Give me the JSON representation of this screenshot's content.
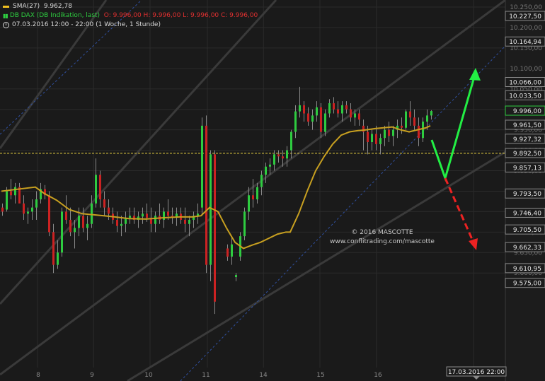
{
  "legend": {
    "sma_label": "SMA(27)",
    "sma_value": "9.962,78",
    "instrument": "DB DAX (DB Indikation, last)",
    "ohlc": "O: 9.996,00  H: 9.996,00  L: 9.996,00  C: 9.996,00",
    "period": "07.03.2016 12:00 - 22:00 (1 Woche, 1 Stunde)"
  },
  "watermark": {
    "line1": "© 2016 MASCOTTE",
    "line2": "www.conflitrading.com/mascotte"
  },
  "colors": {
    "background": "#1a1a1a",
    "up_candle": "#2ecc40",
    "down_candle": "#cc2222",
    "sma": "#c8a020",
    "channel": "#3a3a3a",
    "trend_dotted": "#3050a0",
    "support_line": "#e8d040",
    "arrow_up": "#22ee44",
    "arrow_down": "#ee2222"
  },
  "chart_data": {
    "type": "candlestick",
    "x_ticks": [
      "8",
      "9",
      "10",
      "11",
      "14",
      "15",
      "16"
    ],
    "y_ticks": [
      "10.250,00",
      "10.200,00",
      "10.150,00",
      "10.100,00",
      "10.050,00",
      "10.000,00",
      "9.950,00",
      "9.900,00",
      "9.850,00",
      "9.800,00",
      "9.750,00",
      "9.700,00",
      "9.650,00",
      "9.600,00"
    ],
    "ylim": [
      9565,
      10265
    ],
    "price_boxes": [
      {
        "label": "10.227,50",
        "value": 10227.5
      },
      {
        "label": "10.164,94",
        "value": 10164.94
      },
      {
        "label": "10.066,00",
        "value": 10066.0
      },
      {
        "label": "10.033,50",
        "value": 10033.5
      },
      {
        "label": "9.996,00",
        "value": 9996.0,
        "current": true
      },
      {
        "label": "9.961,50",
        "value": 9961.5
      },
      {
        "label": "9.927,32",
        "value": 9927.32
      },
      {
        "label": "9.892,50",
        "value": 9892.5
      },
      {
        "label": "9.857,13",
        "value": 9857.13
      },
      {
        "label": "9.793,50",
        "value": 9793.5
      },
      {
        "label": "9.746,40",
        "value": 9746.4
      },
      {
        "label": "9.705,50",
        "value": 9705.5
      },
      {
        "label": "9.662,33",
        "value": 9662.33
      },
      {
        "label": "9.610,95",
        "value": 9610.95
      },
      {
        "label": "9.575,00",
        "value": 9575.0
      }
    ],
    "date_box": "17.03.2016 22:00",
    "support_level": 9892.5,
    "sma_path": [
      [
        0,
        9800
      ],
      [
        4,
        9805
      ],
      [
        8,
        9810
      ],
      [
        10,
        9795
      ],
      [
        13,
        9778
      ],
      [
        16,
        9755
      ],
      [
        19,
        9745
      ],
      [
        22,
        9742
      ],
      [
        26,
        9738
      ],
      [
        30,
        9733
      ],
      [
        34,
        9732
      ],
      [
        38,
        9735
      ],
      [
        42,
        9737
      ],
      [
        45,
        9737
      ],
      [
        47,
        9740
      ],
      [
        49,
        9760
      ],
      [
        51,
        9750
      ],
      [
        53,
        9710
      ],
      [
        55,
        9675
      ],
      [
        57,
        9660
      ],
      [
        59,
        9668
      ],
      [
        61,
        9675
      ],
      [
        63,
        9685
      ],
      [
        65,
        9695
      ],
      [
        67,
        9700
      ],
      [
        68,
        9700
      ],
      [
        70,
        9745
      ],
      [
        72,
        9800
      ],
      [
        74,
        9850
      ],
      [
        76,
        9885
      ],
      [
        78,
        9915
      ],
      [
        80,
        9937
      ],
      [
        82,
        9945
      ],
      [
        84,
        9948
      ],
      [
        86,
        9950
      ],
      [
        88,
        9953
      ],
      [
        90,
        9955
      ],
      [
        92,
        9957
      ],
      [
        94,
        9950
      ],
      [
        96,
        9945
      ],
      [
        98,
        9950
      ],
      [
        100,
        9955
      ],
      [
        101,
        9960
      ]
    ],
    "candles": [
      [
        0,
        9760,
        9770,
        9740,
        9750
      ],
      [
        1,
        9755,
        9810,
        9750,
        9800
      ],
      [
        2,
        9800,
        9830,
        9780,
        9790
      ],
      [
        3,
        9790,
        9820,
        9770,
        9810
      ],
      [
        4,
        9810,
        9820,
        9780,
        9770
      ],
      [
        5,
        9770,
        9790,
        9730,
        9745
      ],
      [
        6,
        9745,
        9760,
        9720,
        9750
      ],
      [
        7,
        9750,
        9780,
        9730,
        9760
      ],
      [
        8,
        9760,
        9800,
        9730,
        9780
      ],
      [
        9,
        9780,
        9820,
        9770,
        9805
      ],
      [
        10,
        9805,
        9815,
        9780,
        9790
      ],
      [
        11,
        9790,
        9800,
        9690,
        9700
      ],
      [
        12,
        9700,
        9720,
        9600,
        9620
      ],
      [
        13,
        9620,
        9680,
        9610,
        9650
      ],
      [
        14,
        9650,
        9760,
        9640,
        9750
      ],
      [
        15,
        9750,
        9790,
        9720,
        9730
      ],
      [
        16,
        9730,
        9760,
        9690,
        9700
      ],
      [
        17,
        9700,
        9730,
        9660,
        9710
      ],
      [
        18,
        9710,
        9760,
        9690,
        9740
      ],
      [
        19,
        9740,
        9760,
        9700,
        9710
      ],
      [
        20,
        9710,
        9740,
        9680,
        9720
      ],
      [
        21,
        9720,
        9790,
        9710,
        9770
      ],
      [
        22,
        9770,
        9880,
        9760,
        9840
      ],
      [
        23,
        9840,
        9850,
        9760,
        9780
      ],
      [
        24,
        9780,
        9800,
        9740,
        9760
      ],
      [
        25,
        9760,
        9780,
        9730,
        9745
      ],
      [
        26,
        9745,
        9760,
        9720,
        9730
      ],
      [
        27,
        9730,
        9750,
        9700,
        9715
      ],
      [
        28,
        9715,
        9740,
        9690,
        9720
      ],
      [
        29,
        9720,
        9750,
        9700,
        9735
      ],
      [
        30,
        9735,
        9760,
        9720,
        9740
      ],
      [
        31,
        9740,
        9760,
        9720,
        9730
      ],
      [
        32,
        9730,
        9750,
        9710,
        9738
      ],
      [
        33,
        9738,
        9760,
        9720,
        9745
      ],
      [
        34,
        9745,
        9770,
        9725,
        9735
      ],
      [
        35,
        9735,
        9760,
        9700,
        9720
      ],
      [
        36,
        9720,
        9750,
        9700,
        9740
      ],
      [
        37,
        9740,
        9770,
        9720,
        9730
      ],
      [
        38,
        9730,
        9760,
        9710,
        9750
      ],
      [
        39,
        9750,
        9780,
        9730,
        9740
      ],
      [
        40,
        9740,
        9760,
        9720,
        9735
      ],
      [
        41,
        9735,
        9760,
        9715,
        9745
      ],
      [
        42,
        9745,
        9760,
        9720,
        9730
      ],
      [
        43,
        9730,
        9760,
        9700,
        9720
      ],
      [
        44,
        9720,
        9740,
        9690,
        9730
      ],
      [
        45,
        9730,
        9750,
        9710,
        9740
      ],
      [
        46,
        9740,
        9770,
        9720,
        9745
      ],
      [
        47,
        9760,
        9980,
        9740,
        9960
      ],
      [
        48,
        9960,
        9985,
        9600,
        9620
      ],
      [
        49,
        9620,
        9900,
        9580,
        9890
      ],
      [
        50,
        9890,
        9900,
        9500,
        9530
      ],
      [
        53,
        9660,
        9670,
        9630,
        9640
      ],
      [
        54,
        9640,
        9690,
        9620,
        9670
      ],
      [
        55,
        9590,
        9600,
        9580,
        9595
      ],
      [
        56,
        9640,
        9700,
        9630,
        9690
      ],
      [
        57,
        9690,
        9760,
        9680,
        9750
      ],
      [
        58,
        9750,
        9810,
        9730,
        9790
      ],
      [
        59,
        9790,
        9830,
        9760,
        9780
      ],
      [
        60,
        9780,
        9820,
        9770,
        9810
      ],
      [
        61,
        9810,
        9850,
        9790,
        9840
      ],
      [
        62,
        9840,
        9870,
        9820,
        9860
      ],
      [
        63,
        9860,
        9880,
        9840,
        9865
      ],
      [
        64,
        9865,
        9900,
        9850,
        9890
      ],
      [
        65,
        9890,
        9900,
        9870,
        9885
      ],
      [
        66,
        9885,
        9900,
        9860,
        9880
      ],
      [
        67,
        9880,
        9910,
        9860,
        9900
      ],
      [
        68,
        9900,
        9950,
        9880,
        9945
      ],
      [
        69,
        9945,
        10010,
        9930,
        9995
      ],
      [
        70,
        9995,
        10055,
        9980,
        10010
      ],
      [
        71,
        10010,
        10020,
        9970,
        9990
      ],
      [
        72,
        9990,
        10005,
        9960,
        9970
      ],
      [
        73,
        9970,
        10000,
        9950,
        9985
      ],
      [
        74,
        9985,
        10020,
        9970,
        10005
      ],
      [
        75,
        10005,
        10015,
        9930,
        9945
      ],
      [
        76,
        9945,
        10000,
        9935,
        9990
      ],
      [
        77,
        9990,
        10025,
        9980,
        10015
      ],
      [
        78,
        10015,
        10030,
        9990,
        10000
      ],
      [
        79,
        10000,
        10020,
        9980,
        9990
      ],
      [
        80,
        9990,
        10020,
        9970,
        10010
      ],
      [
        81,
        10010,
        10020,
        9990,
        10000
      ],
      [
        82,
        10000,
        10015,
        9970,
        9980
      ],
      [
        83,
        9980,
        10000,
        9960,
        9990
      ],
      [
        84,
        9990,
        10000,
        9960,
        9975
      ],
      [
        85,
        9960,
        9975,
        9900,
        9945
      ],
      [
        86,
        9945,
        9960,
        9890,
        9920
      ],
      [
        87,
        9920,
        9950,
        9900,
        9940
      ],
      [
        88,
        9940,
        9960,
        9900,
        9915
      ],
      [
        89,
        9915,
        9940,
        9890,
        9930
      ],
      [
        90,
        9930,
        9960,
        9910,
        9950
      ],
      [
        91,
        9950,
        9970,
        9920,
        9935
      ],
      [
        92,
        9935,
        9960,
        9910,
        9950
      ],
      [
        93,
        9950,
        9975,
        9930,
        9960
      ],
      [
        94,
        9960,
        9980,
        9940,
        9955
      ],
      [
        95,
        9955,
        10000,
        9950,
        9995
      ],
      [
        96,
        9995,
        10020,
        9960,
        9980
      ],
      [
        97,
        9980,
        10000,
        9950,
        9960
      ],
      [
        98,
        9960,
        9980,
        9910,
        9930
      ],
      [
        99,
        9930,
        9980,
        9920,
        9970
      ],
      [
        100,
        9970,
        10000,
        9950,
        9985
      ],
      [
        101,
        9985,
        9998,
        9975,
        9996
      ]
    ]
  }
}
